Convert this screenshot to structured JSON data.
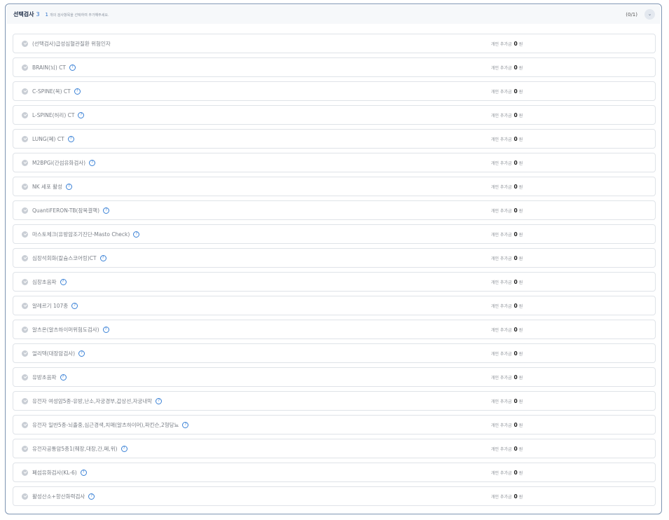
{
  "header": {
    "title": "선택검사",
    "title_num": "3",
    "hint_num": "1",
    "hint": "개의 검사항목을 선택하여 추가해주세요.",
    "count": "(0/1)",
    "toggle_glyph": "⌄"
  },
  "price_label": "개인 추가금",
  "price_amount": "0",
  "price_unit": "원",
  "info_glyph": "?",
  "items": [
    {
      "label": "(선택검사)급성심혈관질환 위험인자",
      "info": false
    },
    {
      "label": "BRAIN(뇌) CT",
      "info": true
    },
    {
      "label": "C-SPINE(목) CT",
      "info": true
    },
    {
      "label": "L-SPINE(허리) CT",
      "info": true
    },
    {
      "label": "LUNG(폐) CT",
      "info": true
    },
    {
      "label": "M2BPGi(간섬유화검사)",
      "info": true
    },
    {
      "label": "NK 세포 활성",
      "info": true
    },
    {
      "label": "QuantiFERON-TB(잠복결핵)",
      "info": true
    },
    {
      "label": "마스토체크(유방암조기진단-Masto Check)",
      "info": true
    },
    {
      "label": "심장석회화(칼슘스코어링)CT",
      "info": true
    },
    {
      "label": "심장초음파",
      "info": true
    },
    {
      "label": "알레르기 107종",
      "info": true
    },
    {
      "label": "알츠온(알츠하이머위험도검사)",
      "info": true
    },
    {
      "label": "얼리텍(대장암검사)",
      "info": true
    },
    {
      "label": "유방초음파",
      "info": true
    },
    {
      "label": "유전자 여성암5종-유방,난소,자궁경부,갑상선,자궁내막",
      "info": true
    },
    {
      "label": "유전자 일반5종-뇌졸중,심근경색,치매(알츠하이머),파킨슨,2형당뇨",
      "info": true
    },
    {
      "label": "유전자공통암5종1(췌장,대장,간,폐,위)",
      "info": true
    },
    {
      "label": "폐섬유화검사(KL-6)",
      "info": true
    },
    {
      "label": "활성산소+항산화력검사",
      "info": true
    }
  ]
}
